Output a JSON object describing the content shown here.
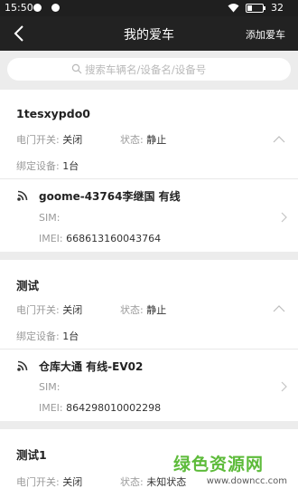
{
  "status_bar": {
    "time": "15:50",
    "battery": "32",
    "battery_fraction": 0.32
  },
  "nav": {
    "title": "我的爱车",
    "add_label": "添加爱车"
  },
  "search": {
    "placeholder": "搜索车辆名/设备名/设备号"
  },
  "labels": {
    "door": "电门开关:",
    "state": "状态:",
    "bound": "绑定设备:",
    "sim": "SIM:",
    "imei": "IMEI:"
  },
  "cars": [
    {
      "name": "1tesxypdo0",
      "door": "关闭",
      "state": "静止",
      "bound": "1台",
      "device": {
        "name": "goome-43764李继国 有线",
        "sim": "",
        "imei": "668613160043764"
      }
    },
    {
      "name": "测试",
      "door": "关闭",
      "state": "静止",
      "bound": "1台",
      "device": {
        "name": "仓库大通 有线-EV02",
        "sim": "",
        "imei": "864298010002298"
      }
    },
    {
      "name": "测试1",
      "door": "关闭",
      "state": "未知状态"
    }
  ],
  "watermark": {
    "brand": "绿色资源网",
    "url": "www.downcc.com"
  },
  "colors": {
    "nav_bg": "#222222",
    "watermark_green": "#5dbb3a"
  }
}
